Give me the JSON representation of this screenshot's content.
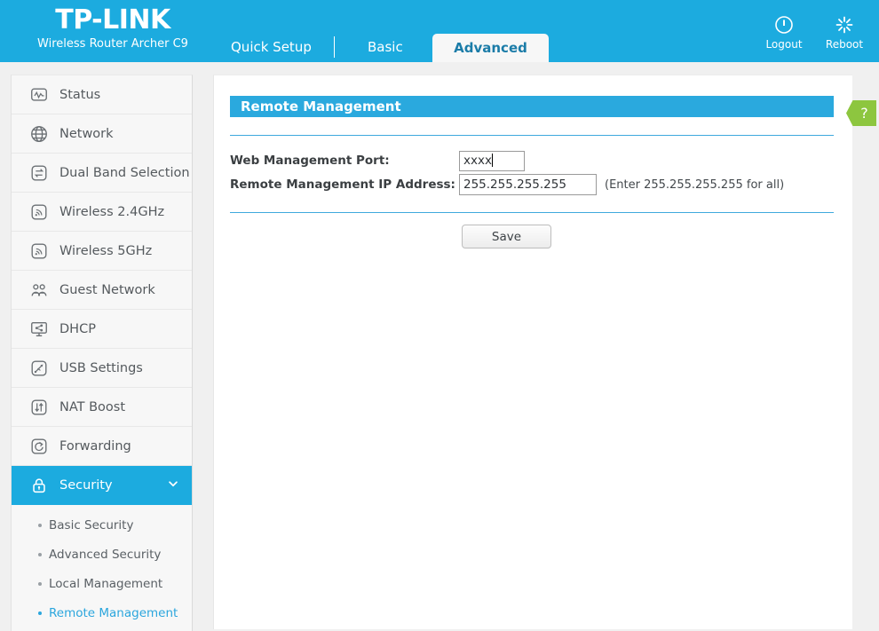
{
  "header": {
    "brand": "TP-LINK",
    "model": "Wireless Router Archer C9",
    "tabs": [
      {
        "label": "Quick Setup",
        "active": false
      },
      {
        "label": "Basic",
        "active": false
      },
      {
        "label": "Advanced",
        "active": true
      }
    ],
    "actions": [
      {
        "label": "Logout",
        "icon": "power-icon"
      },
      {
        "label": "Reboot",
        "icon": "reboot-icon"
      }
    ],
    "bg_color": "#1cabdf"
  },
  "sidebar": {
    "items": [
      {
        "label": "Status",
        "icon": "status-monitor-icon",
        "active": false
      },
      {
        "label": "Network",
        "icon": "globe-icon",
        "active": false
      },
      {
        "label": "Dual Band Selection",
        "icon": "dual-band-icon",
        "active": false
      },
      {
        "label": "Wireless 2.4GHz",
        "icon": "wireless-signal-icon",
        "active": false
      },
      {
        "label": "Wireless 5GHz",
        "icon": "wireless-signal-icon",
        "active": false
      },
      {
        "label": "Guest Network",
        "icon": "guest-users-icon",
        "active": false
      },
      {
        "label": "DHCP",
        "icon": "dhcp-monitor-share-icon",
        "active": false
      },
      {
        "label": "USB Settings",
        "icon": "usb-icon",
        "active": false
      },
      {
        "label": "NAT Boost",
        "icon": "nat-arrows-icon",
        "active": false
      },
      {
        "label": "Forwarding",
        "icon": "forwarding-refresh-icon",
        "active": false
      },
      {
        "label": "Security",
        "icon": "lock-icon",
        "active": true
      }
    ],
    "submenu": [
      {
        "label": "Basic Security",
        "active": false
      },
      {
        "label": "Advanced Security",
        "active": false
      },
      {
        "label": "Local Management",
        "active": false
      },
      {
        "label": "Remote Management",
        "active": true
      }
    ],
    "active_color": "#1cabdf",
    "active_link_color": "#2ba6dd"
  },
  "content": {
    "panel_title": "Remote Management",
    "help_label": "?",
    "help_color": "#8dc63f",
    "fields": [
      {
        "label": "Web Management Port:",
        "value": "xxxx",
        "focused": true
      },
      {
        "label": "Remote Management IP Address:",
        "value": "255.255.255.255",
        "hint": "(Enter 255.255.255.255 for all)",
        "focused": false
      }
    ],
    "save_label": "Save",
    "rule_color": "#3fa9dd"
  }
}
